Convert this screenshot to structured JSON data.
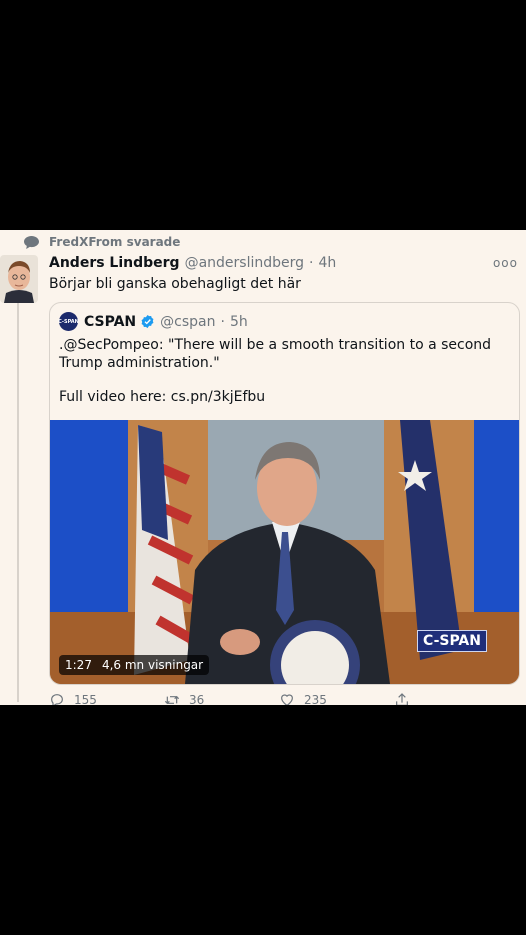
{
  "context": {
    "text": "FredXFrom svarade",
    "icon": "speech-bubble-icon"
  },
  "tweet": {
    "name": "Anders Lindberg",
    "handle": "@anderslindberg",
    "separator": "·",
    "time": "4h",
    "more": "ooo",
    "text": "Börjar bli ganska obehagligt det här"
  },
  "quote": {
    "logo": "C-SPAN",
    "name": "CSPAN",
    "handle": "@cspan",
    "separator": "·",
    "time": "5h",
    "text": ".@SecPompeo: \"There will be a smooth transition to a second Trump administration.\"",
    "link_text": "Full video here: cs.pn/3kjEfbu",
    "video": {
      "duration": "1:27",
      "views": "4,6 mn visningar",
      "overlay": "C-SPAN"
    }
  },
  "actions": {
    "reply_count": "155",
    "retweet_count": "36",
    "like_count": "235"
  },
  "colors": {
    "background": "#fbf4ec",
    "secondary_text": "#6e767d",
    "accent": "#1d9bf0",
    "frame": "#000000"
  }
}
